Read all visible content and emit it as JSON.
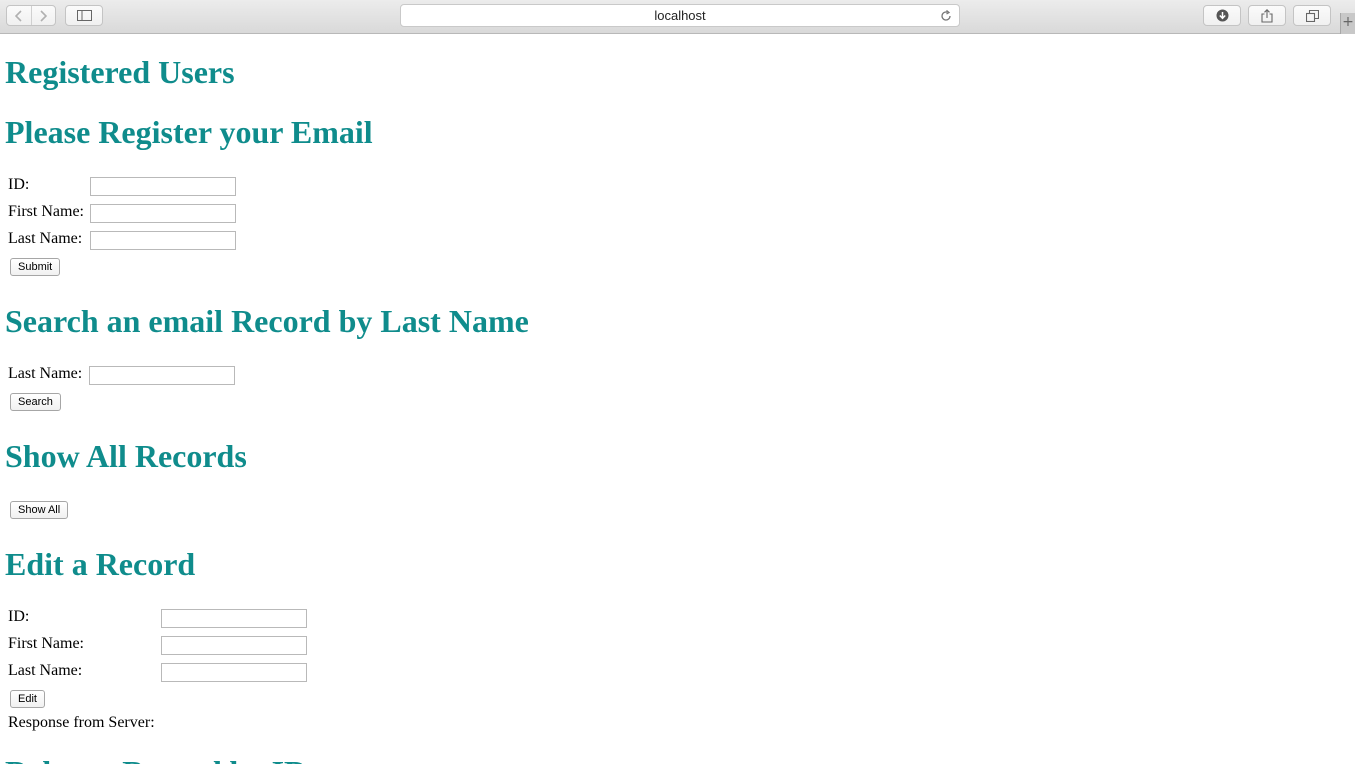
{
  "browser": {
    "url": "localhost",
    "back_icon": "chevron-left-icon",
    "forward_icon": "chevron-right-icon",
    "reload_icon": "reload-icon",
    "download_icon": "download-icon",
    "share_icon": "share-icon",
    "tabs_icon": "tabs-icon",
    "sidebar_icon": "sidebar-icon",
    "new_tab_label": "+"
  },
  "page": {
    "title": "Registered Users",
    "register": {
      "heading": "Please Register your Email",
      "id_label": "ID:",
      "first_name_label": "First Name:",
      "last_name_label": "Last Name:",
      "submit_label": "Submit"
    },
    "search": {
      "heading": "Search an email Record by Last Name",
      "last_name_label": "Last Name:",
      "search_label": "Search"
    },
    "show_all": {
      "heading": "Show All Records",
      "button_label": "Show All"
    },
    "edit": {
      "heading": "Edit a Record",
      "id_label": "ID:",
      "first_name_label": "First Name:",
      "last_name_label": "Last Name:",
      "edit_label": "Edit",
      "response_label": "Response from Server:"
    },
    "delete": {
      "heading": "Delete a Record by ID"
    }
  },
  "colors": {
    "heading": "#0f8c8c"
  }
}
